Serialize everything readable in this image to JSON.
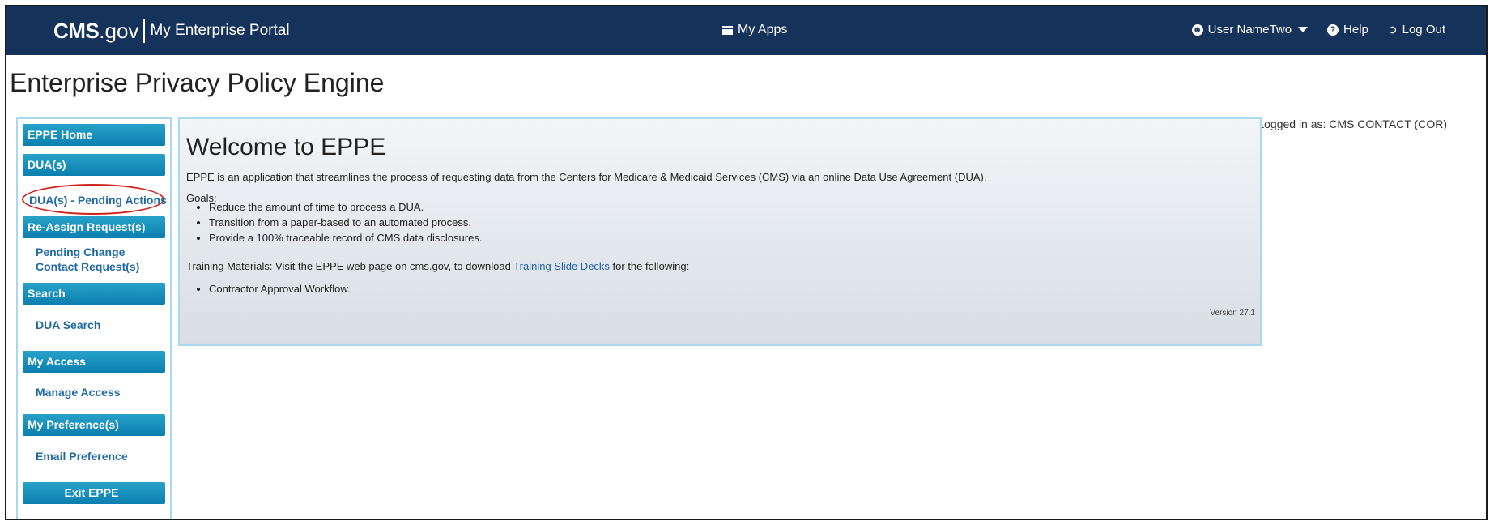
{
  "header": {
    "logo_cms": "CMS",
    "logo_gov": ".gov",
    "portal": "My Enterprise Portal",
    "my_apps": "My Apps",
    "user": "User NameTwo",
    "help": "Help",
    "logout": "Log Out"
  },
  "app_title": "Enterprise Privacy Policy Engine",
  "logged_in": "Logged in as: CMS CONTACT (COR)",
  "sidebar": {
    "eppe_home": "EPPE Home",
    "duas": "DUA(s)",
    "duas_pending": "DUA(s) - Pending Actions",
    "reassign": "Re-Assign Request(s)",
    "pending_change": "Pending Change Contact Request(s)",
    "search": "Search",
    "dua_search": "DUA Search",
    "my_access": "My Access",
    "manage_access": "Manage Access",
    "my_prefs": "My Preference(s)",
    "email_pref": "Email Preference",
    "exit": "Exit EPPE"
  },
  "main": {
    "heading": "Welcome to EPPE",
    "intro": "EPPE is an application that streamlines the process of requesting data from the Centers for Medicare & Medicaid Services (CMS) via an online Data Use Agreement (DUA).",
    "goals_label": "Goals:",
    "goals": [
      "Reduce the amount of time to process a DUA.",
      "Transition from a paper-based to an automated process.",
      "Provide a 100% traceable record of CMS data disclosures."
    ],
    "training_prefix": "Training Materials: Visit the EPPE web page on cms.gov, to download ",
    "training_link": "Training Slide Decks",
    "training_suffix": " for the following:",
    "workflows": [
      "Contractor Approval Workflow."
    ],
    "version": "Version 27.1"
  },
  "colors": {
    "header_bg": "#15325a",
    "sidebar_button": "#0b7fb0",
    "link": "#1f6aa5",
    "highlight": "#d0221c"
  },
  "icons": {
    "my_apps": "list-icon",
    "user": "user-circle-icon",
    "help": "question-circle-icon",
    "logout": "logout-icon"
  }
}
